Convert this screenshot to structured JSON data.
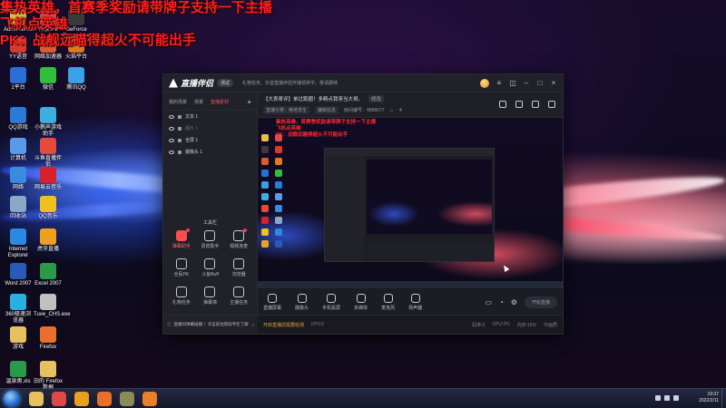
{
  "overlay": {
    "line1": "集热英雄，首赛季奖励请带牌子支持一下主播",
    "line2": "飞机点英雄",
    "line3": "PK：战舰远瞄得超火不可能出手"
  },
  "desktop_icons": [
    {
      "label": "Administrator",
      "color": "#e8c040"
    },
    {
      "label": "海泉.lnk",
      "color": "#e04848"
    },
    {
      "label": "GeForce Experience",
      "color": "#3a3a3a"
    },
    {
      "label": "YY语音",
      "color": "#d83a2a"
    },
    {
      "label": "网络加速器",
      "color": "#e05a30"
    },
    {
      "label": "火焰平台",
      "color": "#e07a20"
    },
    {
      "label": "1平台",
      "color": "#2a6fd8"
    },
    {
      "label": "微信",
      "color": "#2fbf3a"
    },
    {
      "label": "腾讯QQ",
      "color": "#3aa0e8"
    },
    {
      "label": "QQ游戏",
      "color": "#2a7ad8"
    },
    {
      "label": "小鹅声游戏助手",
      "color": "#3ab0e0"
    },
    {
      "label": "计算机",
      "color": "#5a9ae8"
    },
    {
      "label": "斗鱼直播伴侣",
      "color": "#e84a3a"
    },
    {
      "label": "网络",
      "color": "#3a8ae0"
    },
    {
      "label": "网易云音乐",
      "color": "#d8202a"
    },
    {
      "label": "回收站",
      "color": "#8aa8c8"
    },
    {
      "label": "QQ音乐",
      "color": "#f0c020"
    },
    {
      "label": "Internet Explorer",
      "color": "#2a8ae0"
    },
    {
      "label": "虎牙直播",
      "color": "#f0a020"
    },
    {
      "label": "Word 2007",
      "color": "#2a5ab8"
    },
    {
      "label": "Excel 2007",
      "color": "#2a9a4a"
    },
    {
      "label": "360极速浏览器",
      "color": "#2ab0e0"
    },
    {
      "label": "Tuve_CHS.exe",
      "color": "#c0c0c0"
    },
    {
      "label": "游戏",
      "color": "#e8c060"
    },
    {
      "label": "Firefox",
      "color": "#e8702a"
    },
    {
      "label": "温泉奥.xls",
      "color": "#2a9a4a"
    },
    {
      "label": "旧的 Firefox 数据",
      "color": "#e8c060"
    }
  ],
  "app": {
    "logo_text": "直播伴侣",
    "version_badge": "测试",
    "notice": "礼物任务、抖音直播伴侣开播领奖中，敬请期待",
    "left_tabs": [
      "我的场景",
      "场景",
      "直播素材"
    ],
    "active_tab": 2,
    "sources": [
      {
        "label": "文本 1",
        "dim": false
      },
      {
        "label": "图片 1",
        "dim": true
      },
      {
        "label": "全屏 1",
        "dim": false
      },
      {
        "label": "摄像头 1",
        "dim": false
      }
    ],
    "tools_title": "工具栏",
    "tools": [
      {
        "label": "弹幕助手",
        "hot": true,
        "new": true
      },
      {
        "label": "贵宾助手",
        "hot": false,
        "new": false
      },
      {
        "label": "视频连麦",
        "hot": false,
        "new": true
      },
      {
        "label": "全民PK",
        "hot": false,
        "new": false
      },
      {
        "label": "斗鱼Buff",
        "hot": false,
        "new": false
      },
      {
        "label": "浏览器",
        "hot": false,
        "new": false
      },
      {
        "label": "礼物任务",
        "hot": false,
        "new": false
      },
      {
        "label": "弹幕墙",
        "hot": false,
        "new": false
      },
      {
        "label": "主播任务",
        "hot": false,
        "new": false
      },
      {
        "label": "分享",
        "hot": false,
        "new": false
      },
      {
        "label": "数据",
        "hot": false,
        "new": false
      },
      {
        "label": "更多",
        "hot": false,
        "new": false
      }
    ],
    "stream_title": "【大表哥评】单过跑圈！多精点我来当大哥。",
    "edit_label": "修改",
    "meta": {
      "category": "直播分类：绝地求生",
      "edit_tag": "编辑信息",
      "room": "房间编号：4896677",
      "hot": "4"
    },
    "preview": {
      "red_line1": "集热英雄，首赛季奖励请带牌子支持一下主播",
      "red_line2": "飞机点英雄",
      "red_line3": "PK：战舰远瞄得超火不可能出手"
    },
    "controls": [
      {
        "label": "直播屏幕",
        "name": "screen-capture"
      },
      {
        "label": "摄像头",
        "name": "camera"
      },
      {
        "label": "手机投屏",
        "name": "phone-cast"
      },
      {
        "label": "多媒体",
        "name": "media"
      },
      {
        "label": "麦克风",
        "name": "microphone"
      },
      {
        "label": "扬声器",
        "name": "speaker"
      }
    ],
    "start_live": "开始直播",
    "tip": "直播间弹幕插播 ！点击前往帮助专栏了解",
    "status": {
      "warn": "开启直播前需要检测",
      "fps": "FPS:0",
      "bitrate": "码率:0",
      "cpu": "CPU:2%",
      "mem": "内存:15%",
      "quality": "中画质"
    }
  },
  "taskbar": {
    "apps": [
      {
        "name": "file-explorer",
        "color": "#e8c060"
      },
      {
        "name": "chrome",
        "color": "#e04848"
      },
      {
        "name": "media-player",
        "color": "#e8a020"
      },
      {
        "name": "firefox",
        "color": "#e8702a"
      },
      {
        "name": "game-app",
        "color": "#8a8a5a"
      },
      {
        "name": "live-assistant",
        "color": "#e8802a"
      }
    ],
    "time": "19:37",
    "date": "2022/2/11"
  }
}
